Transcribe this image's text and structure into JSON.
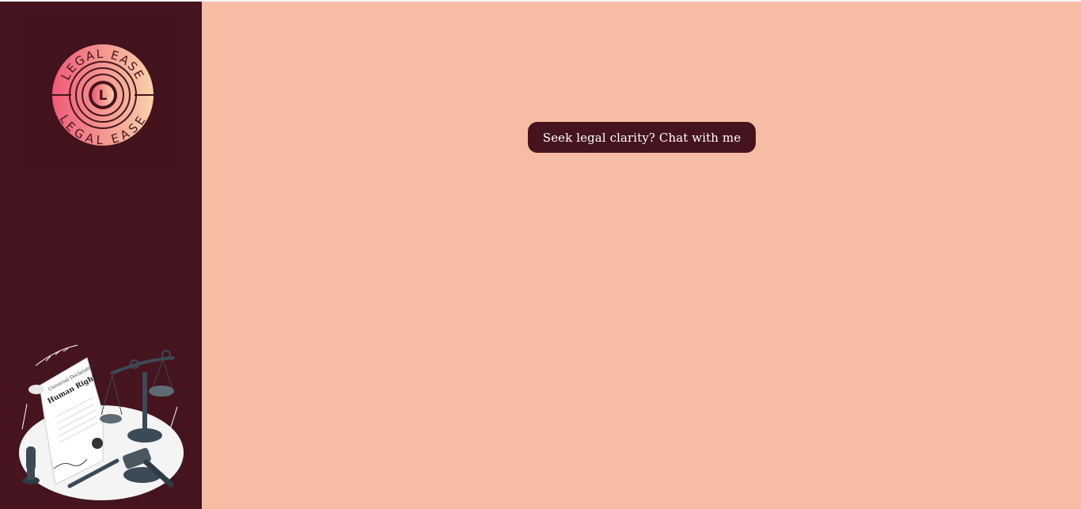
{
  "sidebar": {
    "logo": {
      "top_text": "LEGAL EASE",
      "bottom_text": "LEGAL EASE",
      "monogram": "L",
      "colors": {
        "pink": "#ef5a78",
        "peach": "#f8d2a8",
        "dark": "#45141e"
      }
    },
    "illustration": {
      "icon": "justice-scale-gavel-document-icon",
      "document_title_line1": "Universal Declaration of",
      "document_title_line2": "Human Rights"
    }
  },
  "main": {
    "chat_button_label": "Seek legal clarity? Chat with me"
  },
  "theme": {
    "sidebar_bg": "#45141e",
    "main_bg": "#f7bca4",
    "button_bg": "#45141e",
    "button_text": "#ffffff"
  }
}
